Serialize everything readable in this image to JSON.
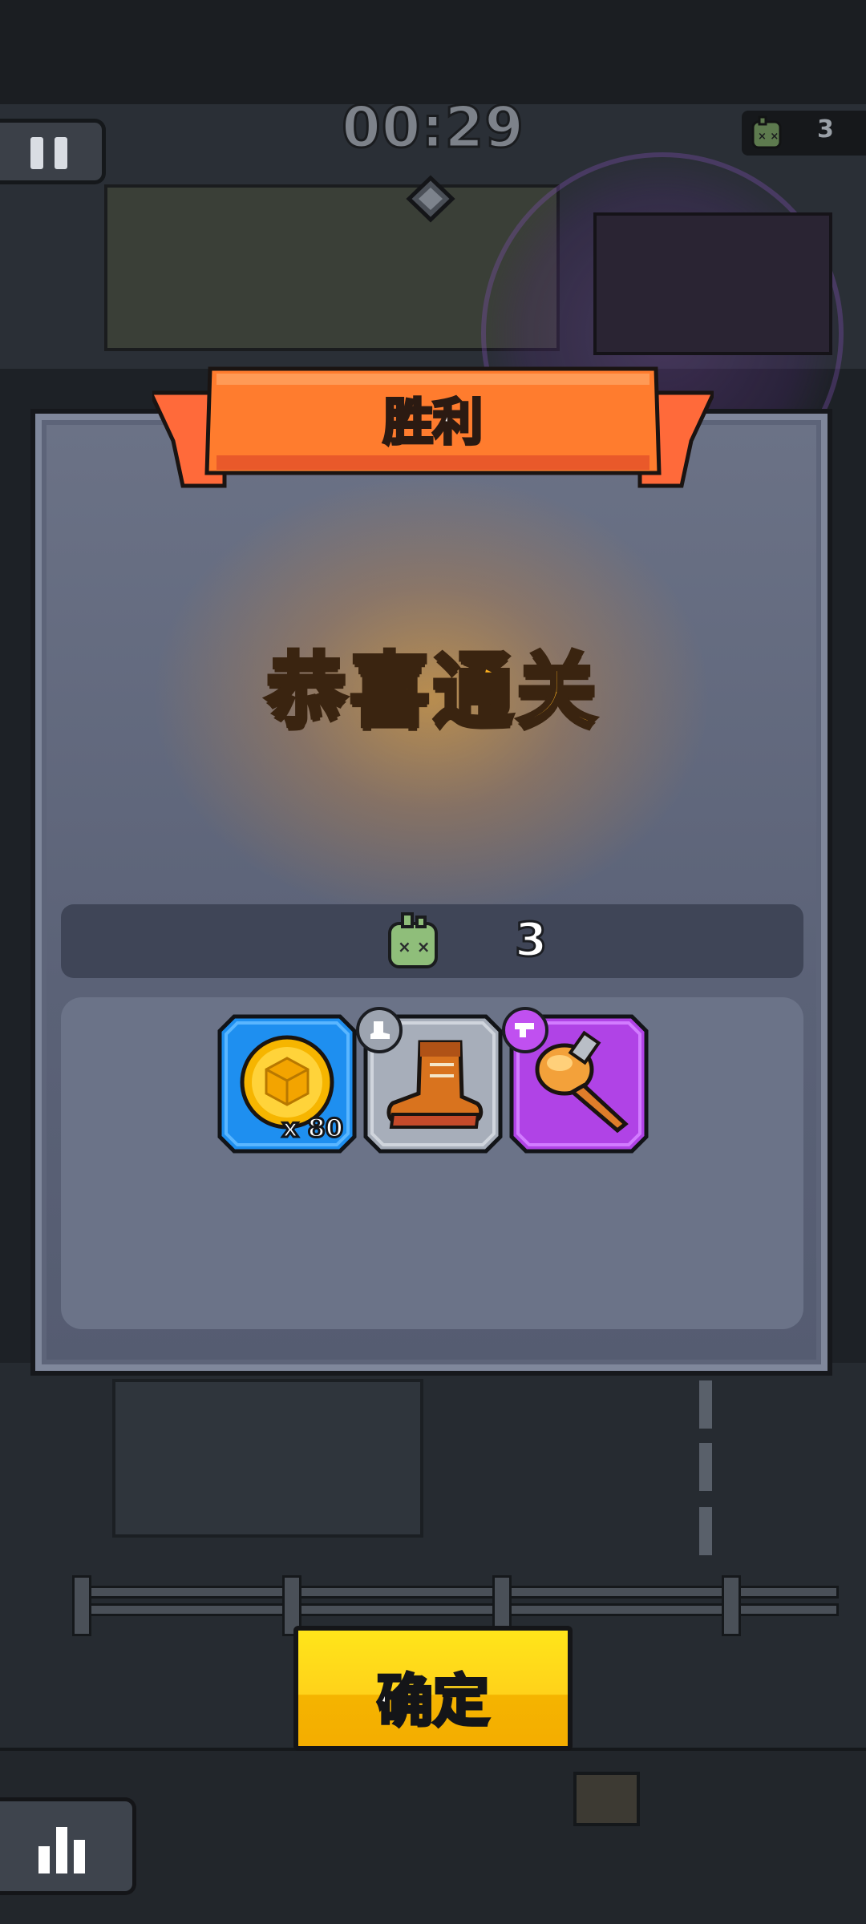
{
  "hud": {
    "timer": "00:29",
    "kill_count": "3",
    "pause_icon": "pause-icon",
    "kill_icon": "zombie-head-icon"
  },
  "result": {
    "ribbon_title": "胜利",
    "headline": "恭喜通关",
    "kills": "3",
    "kill_icon": "zombie-head-icon"
  },
  "rewards": [
    {
      "name": "coin",
      "icon": "gold-coin-icon",
      "quantity": "x 80",
      "rarity_color": "#1e8ff0"
    },
    {
      "name": "boots",
      "icon": "boot-icon",
      "badge_icon": "boot-slot-icon",
      "rarity_color": "#aab1bd"
    },
    {
      "name": "drill",
      "icon": "drill-weapon-icon",
      "badge_icon": "hand-slot-icon",
      "rarity_color": "#b043e6"
    }
  ],
  "buttons": {
    "confirm": "确定",
    "stats_icon": "bar-chart-icon"
  },
  "colors": {
    "ribbon": "#ff7a2e",
    "headline": "#ffb21f",
    "confirm": "#ffd21a"
  }
}
